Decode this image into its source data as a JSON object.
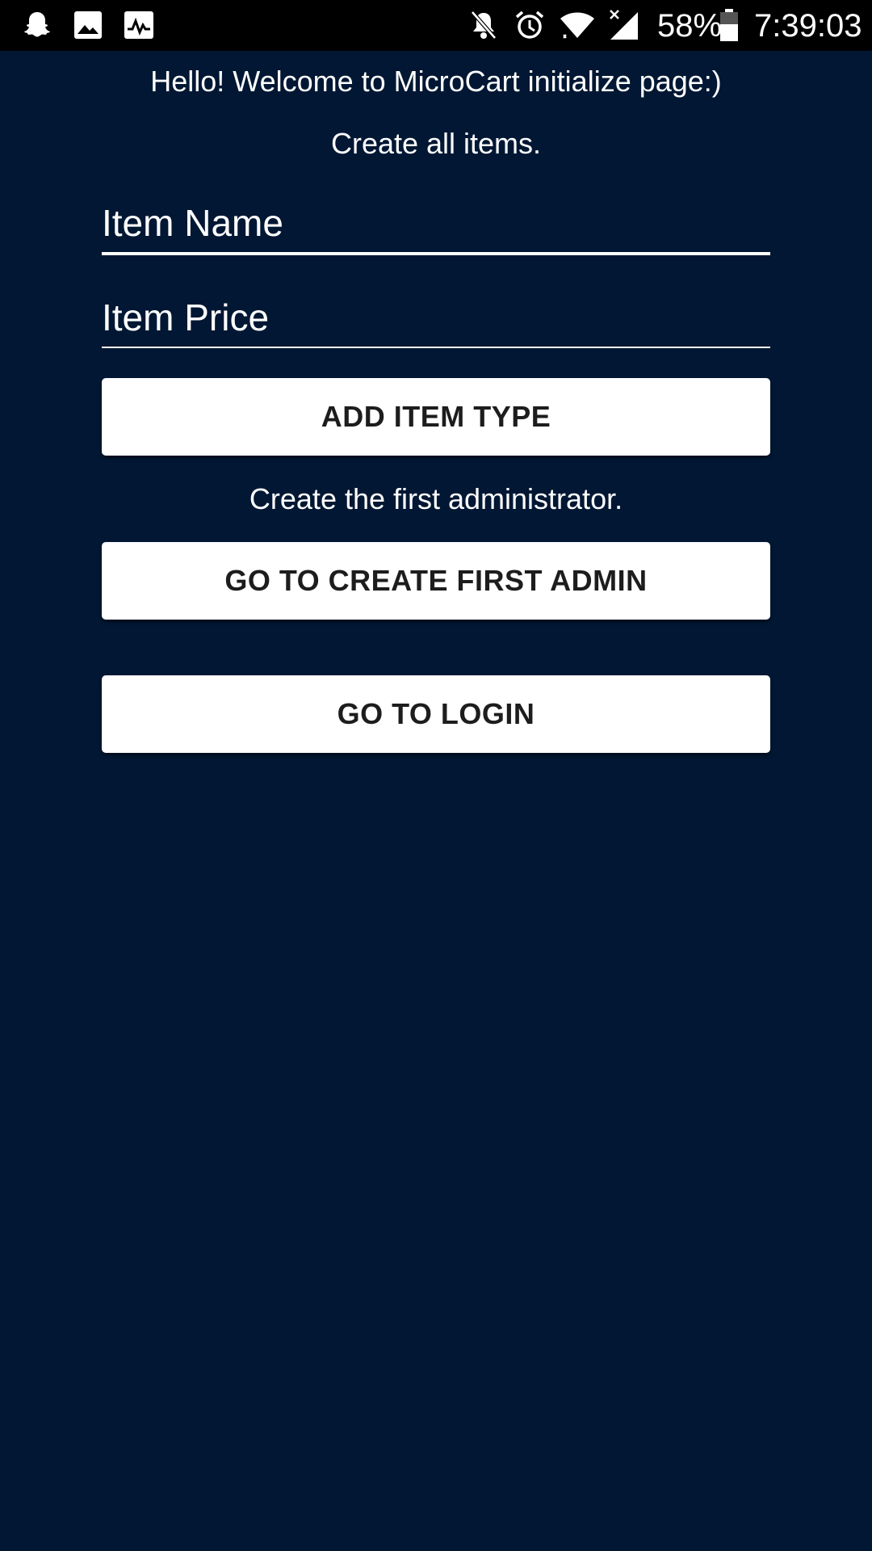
{
  "status_bar": {
    "icons_left": [
      "snapchat-icon",
      "gallery-icon",
      "activity-icon"
    ],
    "icons_right": [
      "mute-notifications-icon",
      "alarm-icon",
      "wifi-icon",
      "cellular-signal-icon",
      "battery-icon"
    ],
    "battery_percent": "58%",
    "time": "7:39:03",
    "colors": {
      "background": "#000000",
      "foreground": "#ffffff"
    }
  },
  "app": {
    "background_color": "#011733",
    "welcome_text": "Hello! Welcome to MicroCart initialize page:)",
    "create_items_text": "Create all items.",
    "item_name": {
      "placeholder": "Item Name",
      "value": ""
    },
    "item_price": {
      "placeholder": "Item Price",
      "value": ""
    },
    "add_item_type_label": "ADD ITEM TYPE",
    "create_admin_text": "Create the first administrator.",
    "create_admin_button_label": "GO TO CREATE FIRST ADMIN",
    "login_button_label": "GO TO LOGIN",
    "button_color": "#ffffff",
    "button_text_color": "#1d1d1d"
  }
}
